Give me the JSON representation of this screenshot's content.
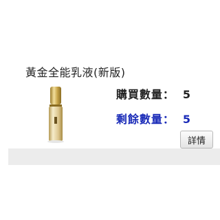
{
  "product": {
    "name": "黃金全能乳液(新版)",
    "purchased_label": "購買數量：",
    "purchased_value": "5",
    "remaining_label": "剩餘數量：",
    "remaining_value": "5",
    "details_label": "詳情"
  },
  "colors": {
    "remaining_text": "#1a2bb8",
    "bottle_gold": "#c9a64a",
    "footer_strip": "#ececec"
  }
}
